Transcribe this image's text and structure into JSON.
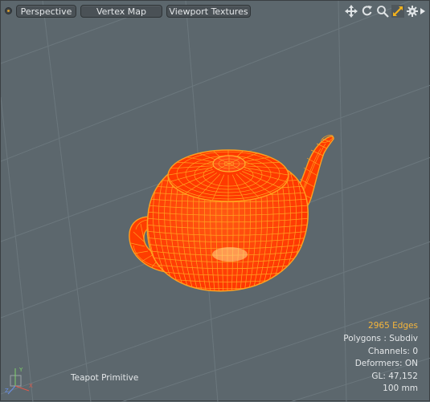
{
  "viewport": {
    "toolbar": {
      "buttons": [
        {
          "label": "Perspective"
        },
        {
          "label": "Vertex Map"
        },
        {
          "label": "Viewport Textures"
        }
      ],
      "icons": [
        "move-view-icon",
        "rotate-view-icon",
        "zoom-view-icon",
        "maximize-view-icon",
        "settings-gear-icon",
        "expand-arrow-icon"
      ]
    },
    "selection_label": "Teapot Primitive",
    "info": {
      "edges": "2965 Edges",
      "polygons": "Polygons : Subdiv",
      "channels": "Channels: 0",
      "deformers": "Deformers: ON",
      "gl": "GL: 47,152",
      "unit": "100 mm"
    },
    "axis_gizmo": {
      "y": "Y",
      "x": "X",
      "z": "Z"
    },
    "colors": {
      "background": "#5c676d",
      "wire": "#ff9a1a",
      "fill": "#ff3d00",
      "edge_highlight": "#f5b53b"
    }
  }
}
